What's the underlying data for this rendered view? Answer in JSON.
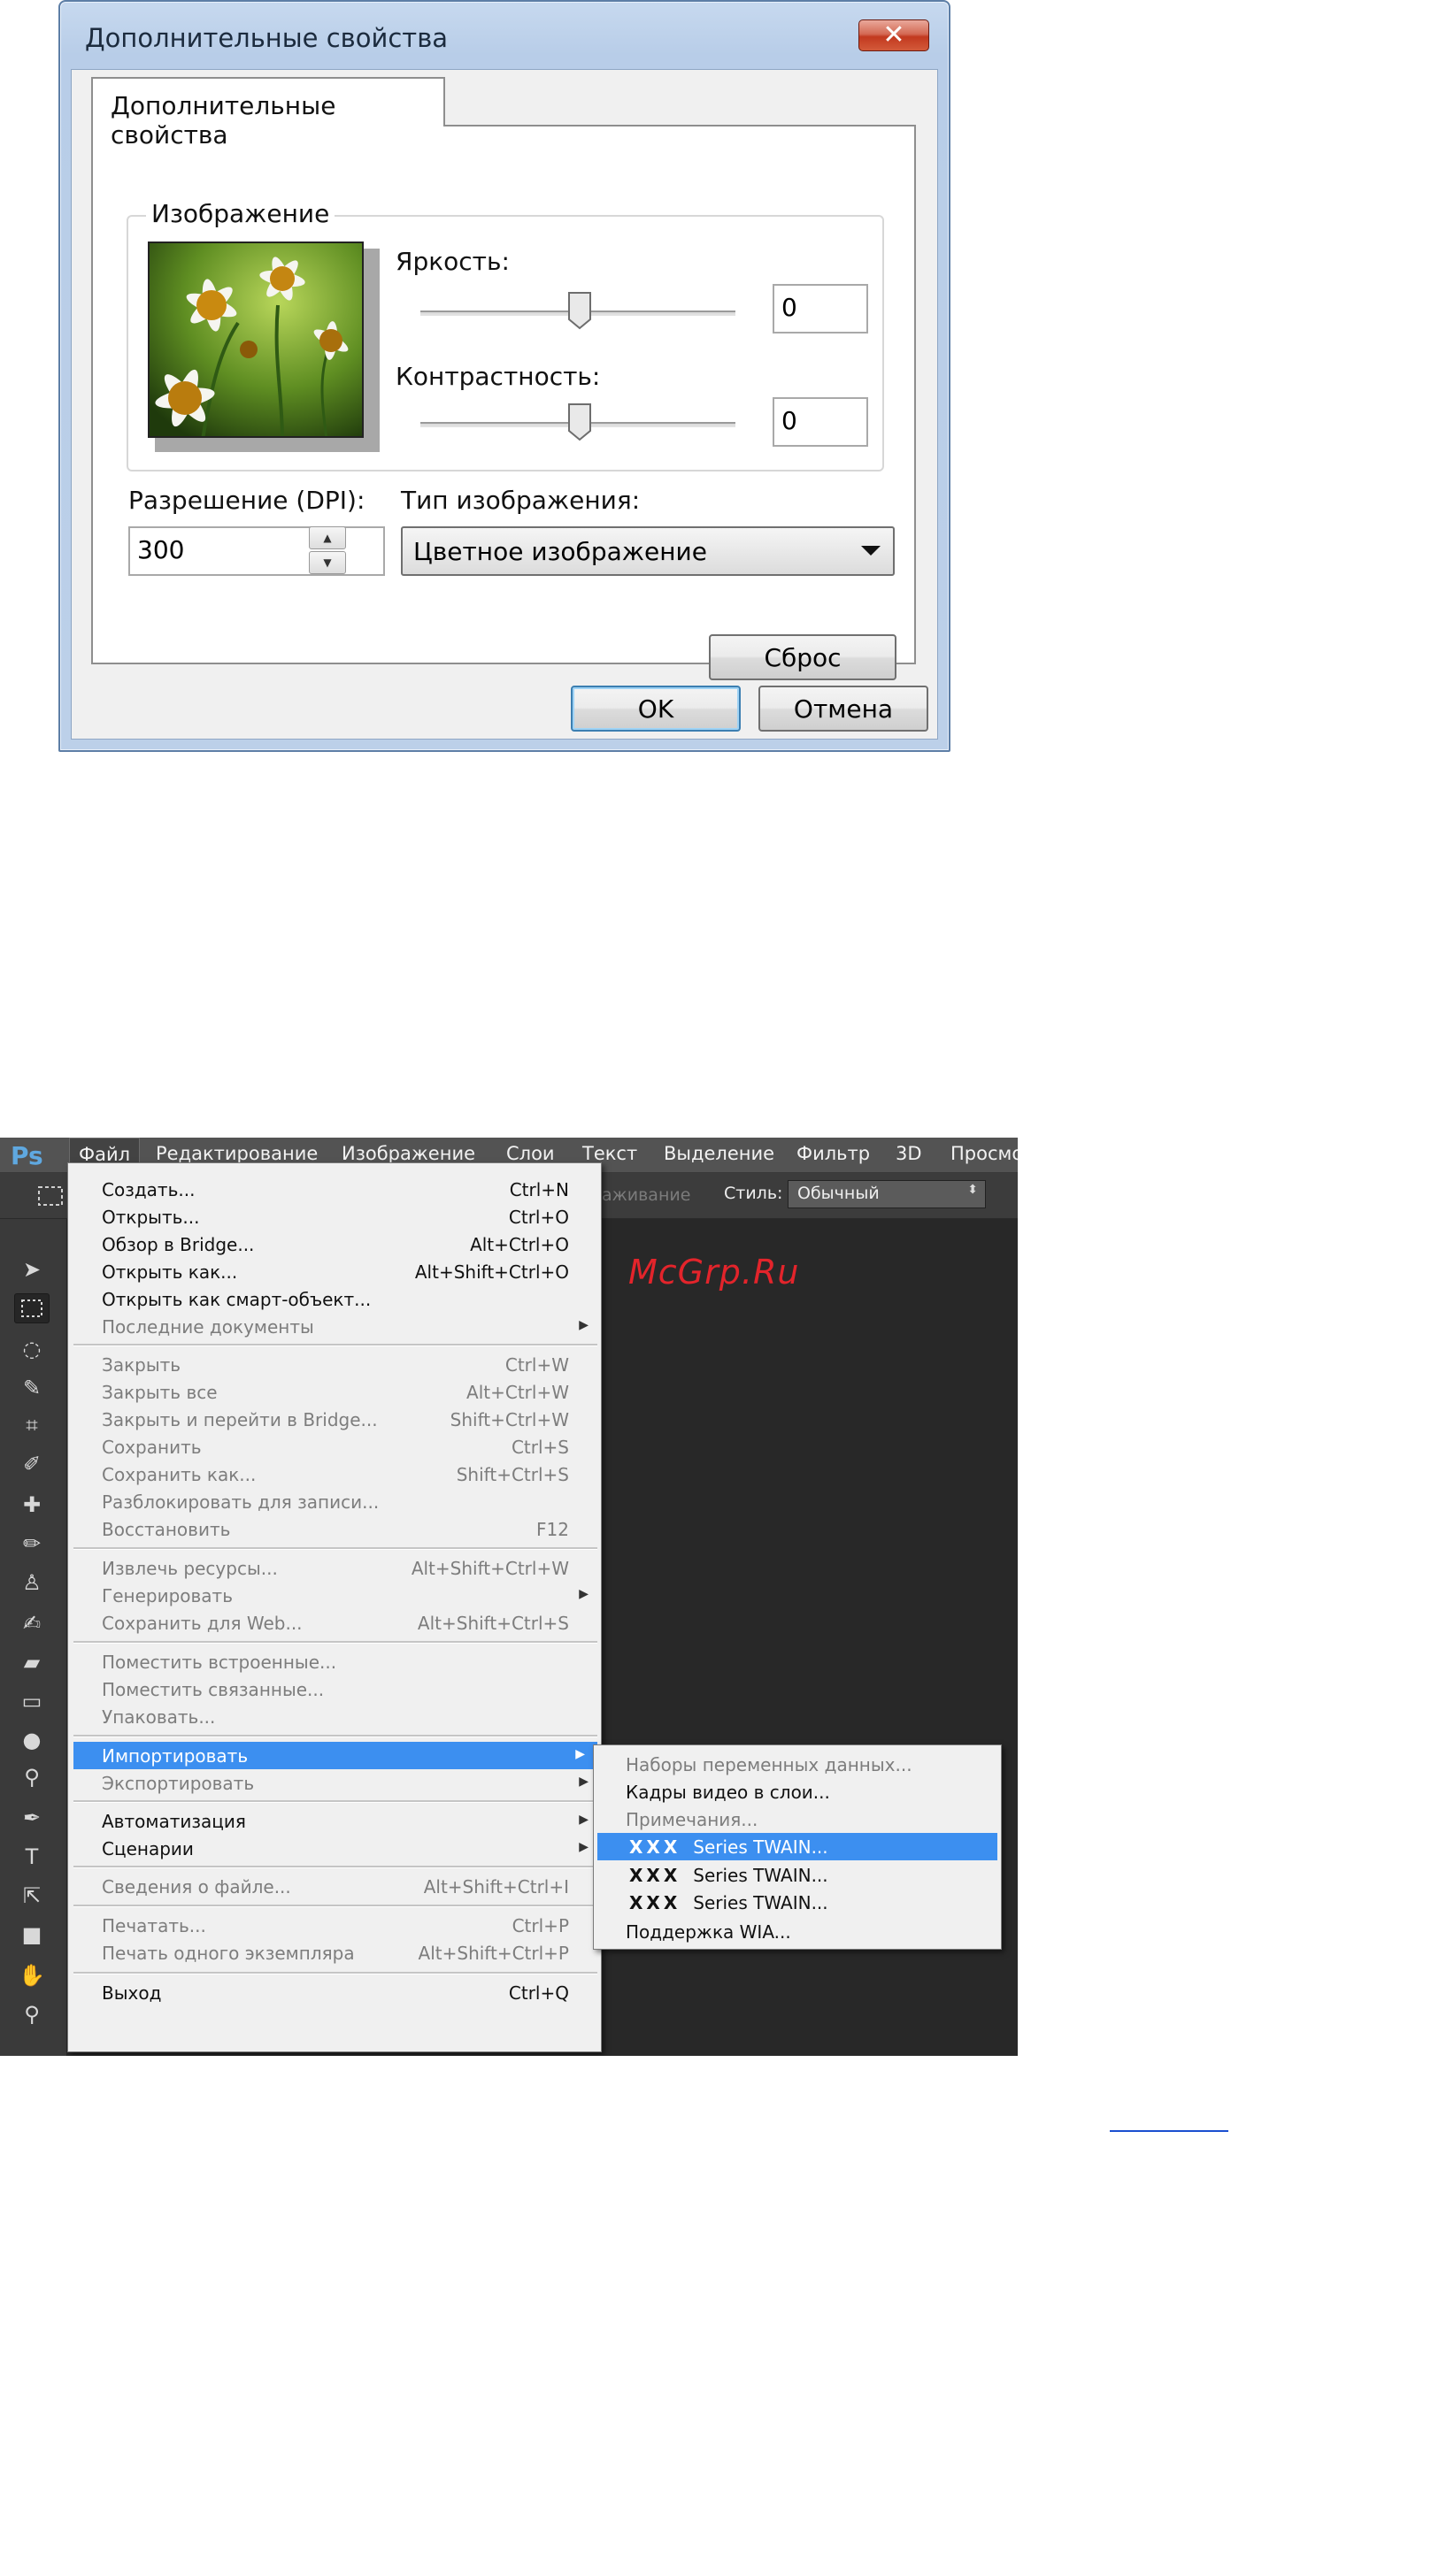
{
  "dialog": {
    "title": "Дополнительные свойства",
    "close_symbol": "✕",
    "tab_label": "Дополнительные свойства",
    "group_label": "Изображение",
    "brightness_label": "Яркость:",
    "brightness_value": "0",
    "contrast_label": "Контрастность:",
    "contrast_value": "0",
    "resolution_label": "Разрешение (DPI):",
    "resolution_value": "300",
    "image_type_label": "Тип изображения:",
    "image_type_value": "Цветное изображение",
    "reset_label": "Сброс",
    "ok_label": "OK",
    "cancel_label": "Отмена"
  },
  "photoshop": {
    "logo": "Ps",
    "menubar": [
      "Файл",
      "Редактирование",
      "Изображение",
      "Слои",
      "Текст",
      "Выделение",
      "Фильтр",
      "3D",
      "Просмо"
    ],
    "options_faded": "аживание",
    "style_label": "Стиль:",
    "style_value": "Обычный",
    "watermark": "McGrp.Ru",
    "file_menu": [
      {
        "label": "Создать...",
        "shortcut": "Ctrl+N"
      },
      {
        "label": "Открыть...",
        "shortcut": "Ctrl+O"
      },
      {
        "label": "Обзор в Bridge...",
        "shortcut": "Alt+Ctrl+O"
      },
      {
        "label": "Открыть как...",
        "shortcut": "Alt+Shift+Ctrl+O"
      },
      {
        "label": "Открыть как смарт-объект...",
        "shortcut": ""
      },
      {
        "label": "Последние документы",
        "shortcut": ""
      },
      {
        "label": "Закрыть",
        "shortcut": "Ctrl+W"
      },
      {
        "label": "Закрыть все",
        "shortcut": "Alt+Ctrl+W"
      },
      {
        "label": "Закрыть и перейти в Bridge...",
        "shortcut": "Shift+Ctrl+W"
      },
      {
        "label": "Сохранить",
        "shortcut": "Ctrl+S"
      },
      {
        "label": "Сохранить как...",
        "shortcut": "Shift+Ctrl+S"
      },
      {
        "label": "Разблокировать для записи...",
        "shortcut": ""
      },
      {
        "label": "Восстановить",
        "shortcut": "F12"
      },
      {
        "label": "Извлечь ресурсы...",
        "shortcut": "Alt+Shift+Ctrl+W"
      },
      {
        "label": "Генерировать",
        "shortcut": ""
      },
      {
        "label": "Сохранить для Web...",
        "shortcut": "Alt+Shift+Ctrl+S"
      },
      {
        "label": "Поместить встроенные...",
        "shortcut": ""
      },
      {
        "label": "Поместить связанные...",
        "shortcut": ""
      },
      {
        "label": "Упаковать...",
        "shortcut": ""
      },
      {
        "label": "Импортировать",
        "shortcut": ""
      },
      {
        "label": "Экспортировать",
        "shortcut": ""
      },
      {
        "label": "Автоматизация",
        "shortcut": ""
      },
      {
        "label": "Сценарии",
        "shortcut": ""
      },
      {
        "label": "Сведения о файле...",
        "shortcut": "Alt+Shift+Ctrl+I"
      },
      {
        "label": "Печатать...",
        "shortcut": "Ctrl+P"
      },
      {
        "label": "Печать одного экземпляра",
        "shortcut": "Alt+Shift+Ctrl+P"
      },
      {
        "label": "Выход",
        "shortcut": "Ctrl+Q"
      }
    ],
    "submenu_arrow": "▶",
    "import_submenu": [
      {
        "label": "Наборы переменных данных..."
      },
      {
        "label": "Кадры видео в слои..."
      },
      {
        "label": "Примечания..."
      },
      {
        "prefix": "XXX",
        "label": "Series TWAIN..."
      },
      {
        "prefix": "XXX",
        "label": "Series TWAIN..."
      },
      {
        "prefix": "XXX",
        "label": "Series TWAIN..."
      },
      {
        "label": "Поддержка WIA..."
      }
    ]
  },
  "colors": {
    "highlight": "#3c8ff0",
    "watermark": "#e3242b",
    "ps_background": "#282828"
  }
}
